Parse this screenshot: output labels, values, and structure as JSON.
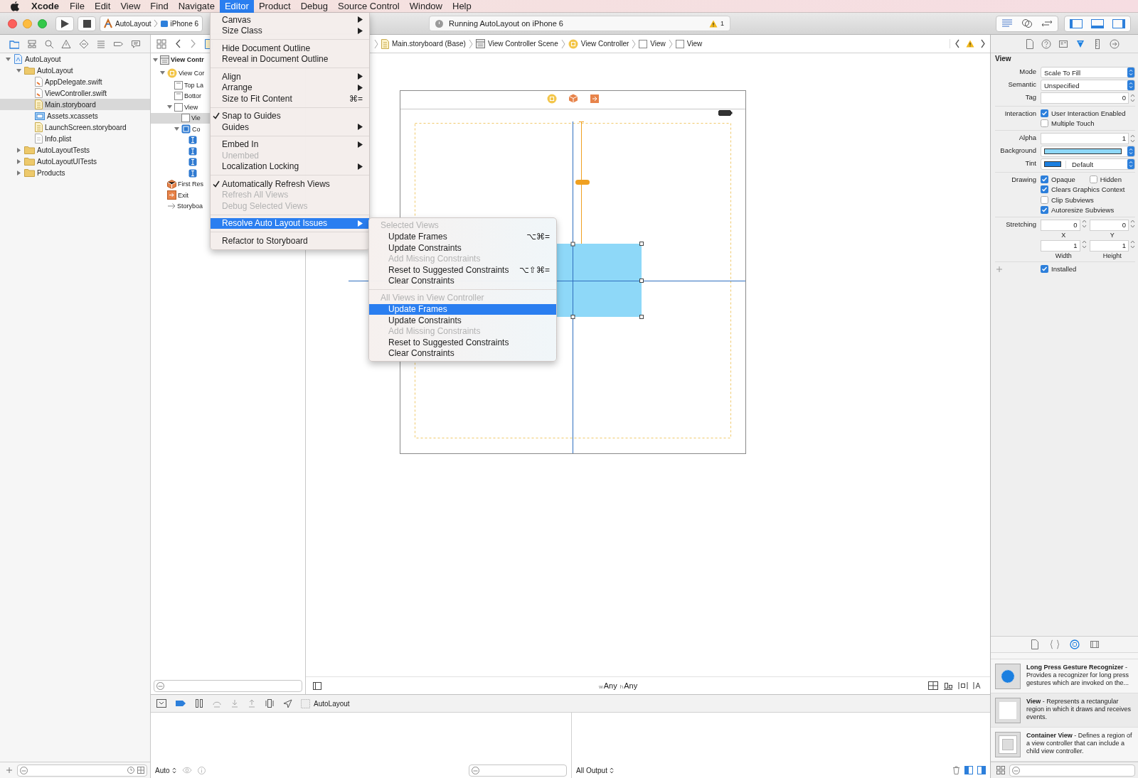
{
  "menubar": {
    "app": "Xcode",
    "menus": [
      {
        "label": "File",
        "selected": false
      },
      {
        "label": "Edit",
        "selected": false
      },
      {
        "label": "View",
        "selected": false
      },
      {
        "label": "Find",
        "selected": false
      },
      {
        "label": "Navigate",
        "selected": false
      },
      {
        "label": "Editor",
        "selected": true
      },
      {
        "label": "Product",
        "selected": false
      },
      {
        "label": "Debug",
        "selected": false
      },
      {
        "label": "Source Control",
        "selected": false
      },
      {
        "label": "Window",
        "selected": false
      },
      {
        "label": "Help",
        "selected": false
      }
    ]
  },
  "toolbar": {
    "scheme": "AutoLayout",
    "device": "iPhone 6",
    "activity": "Running AutoLayout on iPhone 6",
    "warnings": "1",
    "panels": [
      {
        "on": true
      },
      {
        "on": true
      },
      {
        "on": true
      }
    ]
  },
  "navigator": {
    "tree": [
      {
        "label": "AutoLayout",
        "kind": "project",
        "expanded": true,
        "selected": false,
        "children": [
          {
            "label": "AutoLayout",
            "kind": "folder",
            "expanded": true,
            "selected": false,
            "children": [
              {
                "label": "AppDelegate.swift",
                "kind": "swift",
                "selected": false
              },
              {
                "label": "ViewController.swift",
                "kind": "swift",
                "selected": false
              },
              {
                "label": "Main.storyboard",
                "kind": "storyboard",
                "selected": true
              },
              {
                "label": "Assets.xcassets",
                "kind": "assets",
                "selected": false
              },
              {
                "label": "LaunchScreen.storyboard",
                "kind": "storyboard",
                "selected": false
              },
              {
                "label": "Info.plist",
                "kind": "plist",
                "selected": false
              }
            ]
          },
          {
            "label": "AutoLayoutTests",
            "kind": "folder",
            "expanded": false,
            "selected": false
          },
          {
            "label": "AutoLayoutUITests",
            "kind": "folder",
            "expanded": false,
            "selected": false
          },
          {
            "label": "Products",
            "kind": "folder",
            "expanded": false,
            "selected": false
          }
        ]
      }
    ]
  },
  "jump_bar": {
    "crumbs": [
      {
        "label": "Main.storyboard (Base)",
        "kind": "storyboard"
      },
      {
        "label": "View Controller Scene",
        "kind": "scene"
      },
      {
        "label": "View Controller",
        "kind": "controller"
      },
      {
        "label": "View",
        "kind": "view"
      },
      {
        "label": "View",
        "kind": "view"
      }
    ]
  },
  "outline": {
    "tree": [
      {
        "label": "View Contr",
        "kind": "scene",
        "expanded": true,
        "selected": false,
        "children": [
          {
            "label": "View Cor",
            "kind": "controller",
            "expanded": true,
            "selected": false,
            "children": [
              {
                "label": "Top La",
                "kind": "guide",
                "selected": false
              },
              {
                "label": "Bottor",
                "kind": "guide",
                "selected": false
              },
              {
                "label": "View",
                "kind": "view",
                "expanded": true,
                "selected": false,
                "children": [
                  {
                    "label": "Vie",
                    "kind": "view",
                    "selected": true
                  },
                  {
                    "label": "Co",
                    "kind": "constraints",
                    "expanded": true,
                    "selected": false,
                    "children": [
                      {
                        "kind": "constraint",
                        "selected": false
                      },
                      {
                        "kind": "constraint",
                        "selected": false
                      },
                      {
                        "kind": "constraint",
                        "selected": false
                      },
                      {
                        "kind": "constraint",
                        "selected": false
                      }
                    ]
                  }
                ]
              }
            ]
          },
          {
            "label": "First Res",
            "kind": "responder",
            "selected": false
          },
          {
            "label": "Exit",
            "kind": "exit",
            "selected": false
          },
          {
            "label": "Storyboa",
            "kind": "entry",
            "selected": false
          }
        ]
      }
    ]
  },
  "editor_menu": {
    "groups": [
      [
        {
          "label": "Canvas",
          "submenu": true,
          "checked": false,
          "disabled": false,
          "selected": false
        },
        {
          "label": "Size Class",
          "submenu": true,
          "checked": false,
          "disabled": false,
          "selected": false
        }
      ],
      [
        {
          "label": "Hide Document Outline",
          "submenu": false,
          "checked": false,
          "disabled": false,
          "selected": false
        },
        {
          "label": "Reveal in Document Outline",
          "submenu": false,
          "checked": false,
          "disabled": false,
          "selected": false
        }
      ],
      [
        {
          "label": "Align",
          "submenu": true,
          "checked": false,
          "disabled": false,
          "selected": false
        },
        {
          "label": "Arrange",
          "submenu": true,
          "checked": false,
          "disabled": false,
          "selected": false
        },
        {
          "label": "Size to Fit Content",
          "shortcut": "⌘=",
          "submenu": false,
          "checked": false,
          "disabled": false,
          "selected": false
        }
      ],
      [
        {
          "label": "Snap to Guides",
          "submenu": false,
          "checked": true,
          "disabled": false,
          "selected": false
        },
        {
          "label": "Guides",
          "submenu": true,
          "checked": false,
          "disabled": false,
          "selected": false
        }
      ],
      [
        {
          "label": "Embed In",
          "submenu": true,
          "checked": false,
          "disabled": false,
          "selected": false
        },
        {
          "label": "Unembed",
          "submenu": false,
          "checked": false,
          "disabled": true,
          "selected": false
        },
        {
          "label": "Localization Locking",
          "submenu": true,
          "checked": false,
          "disabled": false,
          "selected": false
        }
      ],
      [
        {
          "label": "Automatically Refresh Views",
          "submenu": false,
          "checked": true,
          "disabled": false,
          "selected": false
        },
        {
          "label": "Refresh All Views",
          "submenu": false,
          "checked": false,
          "disabled": true,
          "selected": false
        },
        {
          "label": "Debug Selected Views",
          "submenu": false,
          "checked": false,
          "disabled": true,
          "selected": false
        }
      ],
      [
        {
          "label": "Resolve Auto Layout Issues",
          "submenu": true,
          "checked": false,
          "disabled": false,
          "selected": true
        }
      ],
      [
        {
          "label": "Refactor to Storyboard",
          "submenu": false,
          "checked": false,
          "disabled": false,
          "selected": false
        }
      ]
    ]
  },
  "submenu": {
    "sections": [
      {
        "title": "Selected Views",
        "items": [
          {
            "label": "Update Frames",
            "shortcut": "⌥⌘=",
            "disabled": false,
            "selected": false
          },
          {
            "label": "Update Constraints",
            "disabled": false,
            "selected": false
          },
          {
            "label": "Add Missing Constraints",
            "disabled": true,
            "selected": false
          },
          {
            "label": "Reset to Suggested Constraints",
            "shortcut": "⌥⇧⌘=",
            "disabled": false,
            "selected": false
          },
          {
            "label": "Clear Constraints",
            "disabled": false,
            "selected": false
          }
        ]
      },
      {
        "title": "All Views in View Controller",
        "items": [
          {
            "label": "Update Frames",
            "disabled": false,
            "selected": true
          },
          {
            "label": "Update Constraints",
            "disabled": false,
            "selected": false
          },
          {
            "label": "Add Missing Constraints",
            "disabled": true,
            "selected": false
          },
          {
            "label": "Reset to Suggested Constraints",
            "disabled": false,
            "selected": false
          },
          {
            "label": "Clear Constraints",
            "disabled": false,
            "selected": false
          }
        ]
      }
    ]
  },
  "canvas": {
    "size_class": {
      "width_prefix": "w",
      "width_value": "Any",
      "height_prefix": "h",
      "height_value": "Any"
    }
  },
  "inspector": {
    "tabs": [
      {
        "selected": false
      },
      {
        "selected": false
      },
      {
        "selected": false
      },
      {
        "selected": true
      },
      {
        "selected": false
      },
      {
        "selected": false
      }
    ],
    "title": "View",
    "groups": [
      [
        {
          "kind": "popup",
          "label": "Mode",
          "value": "Scale To Fill"
        },
        {
          "kind": "popup",
          "label": "Semantic",
          "value": "Unspecified"
        },
        {
          "kind": "number",
          "label": "Tag",
          "value": "0"
        }
      ],
      [
        {
          "kind": "checks",
          "label": "Interaction",
          "rows": [
            [
              {
                "label": "User Interaction Enabled",
                "checked": true
              }
            ],
            [
              {
                "label": "Multiple Touch",
                "checked": false
              }
            ]
          ]
        }
      ],
      [
        {
          "kind": "number",
          "label": "Alpha",
          "value": "1"
        },
        {
          "kind": "color",
          "label": "Background",
          "color": "#8ed8f8"
        },
        {
          "kind": "tint",
          "label": "Tint",
          "color": "#1b7fe0",
          "value": "Default"
        }
      ],
      [
        {
          "kind": "checks",
          "label": "Drawing",
          "rows": [
            [
              {
                "label": "Opaque",
                "checked": true
              },
              {
                "label": "Hidden",
                "checked": false
              }
            ],
            [
              {
                "label": "Clears Graphics Context",
                "checked": true
              }
            ],
            [
              {
                "label": "Clip Subviews",
                "checked": false
              }
            ],
            [
              {
                "label": "Autoresize Subviews",
                "checked": true
              }
            ]
          ]
        }
      ],
      [
        {
          "kind": "pairs",
          "label": "Stretching",
          "fields": [
            {
              "value": "0",
              "caption": "X"
            },
            {
              "value": "0",
              "caption": "Y"
            },
            {
              "value": "1",
              "caption": "Width"
            },
            {
              "value": "1",
              "caption": "Height"
            }
          ]
        }
      ],
      [
        {
          "kind": "installed",
          "rows": [
            [
              {
                "label": "Installed",
                "checked": true
              }
            ]
          ]
        }
      ]
    ]
  },
  "library": {
    "tabs": [
      {
        "selected": false
      },
      {
        "selected": false
      },
      {
        "selected": true
      },
      {
        "selected": false
      }
    ],
    "items": [
      {
        "kind": "gesture",
        "text": "**Long Press Gesture Recognizer** - Provides a recognizer for long press gestures which are invoked on the..."
      },
      {
        "kind": "view",
        "text": "**View** - Represents a rectangular region in which it draws and receives events."
      },
      {
        "kind": "container",
        "text": "**Container View** - Defines a region of a view controller that can include a child view controller."
      }
    ]
  },
  "debug": {
    "target": "AutoLayout",
    "mode": "Auto",
    "output": "All Output"
  }
}
